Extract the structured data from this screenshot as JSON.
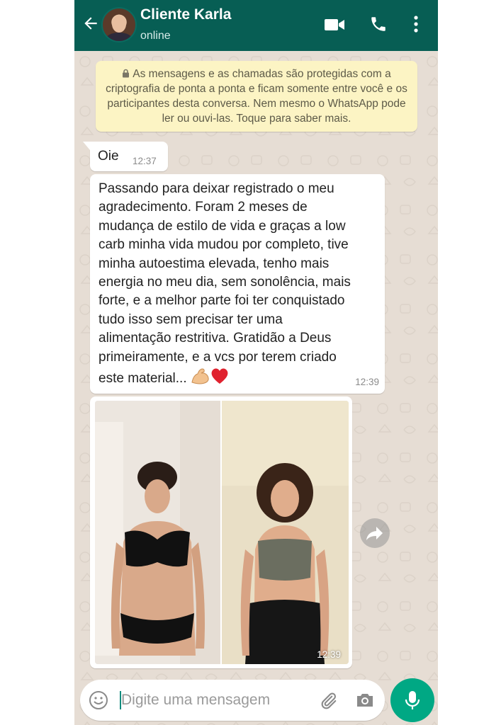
{
  "header": {
    "title": "Cliente Karla",
    "status": "online"
  },
  "encryption_notice": "As mensagens e as chamadas são protegidas com a criptografia de ponta a ponta e ficam somente entre você e os participantes desta conversa. Nem mesmo o WhatsApp pode ler ou ouvi-las. Toque para saber mais.",
  "messages": [
    {
      "text": "Oie",
      "time": "12:37"
    },
    {
      "text": "Passando para deixar registrado o meu\nagradecimento. Foram 2 meses de\nmudança de estilo de vida e graças a low\ncarb minha vida mudou por completo, tive\nminha autoestima elevada, tenho mais\nenergia no meu dia, sem sonolência, mais\nforte, e a melhor parte foi ter conquistado\ntudo isso sem precisar ter uma\nalimentação restritiva. Gratidão a Deus\nprimeiramente, e a vcs por terem criado\neste material...",
      "emojis": [
        "flexed-biceps",
        "red-heart"
      ],
      "time": "12:39"
    },
    {
      "type": "image",
      "description_icon": "before-after-photo",
      "time": "12:39"
    }
  ],
  "input": {
    "placeholder": "Digite uma mensagem"
  },
  "colors": {
    "header": "#075e54",
    "accent": "#00a884",
    "notice_bg": "#fcf4c4",
    "chat_bg": "#e6ddd4"
  }
}
